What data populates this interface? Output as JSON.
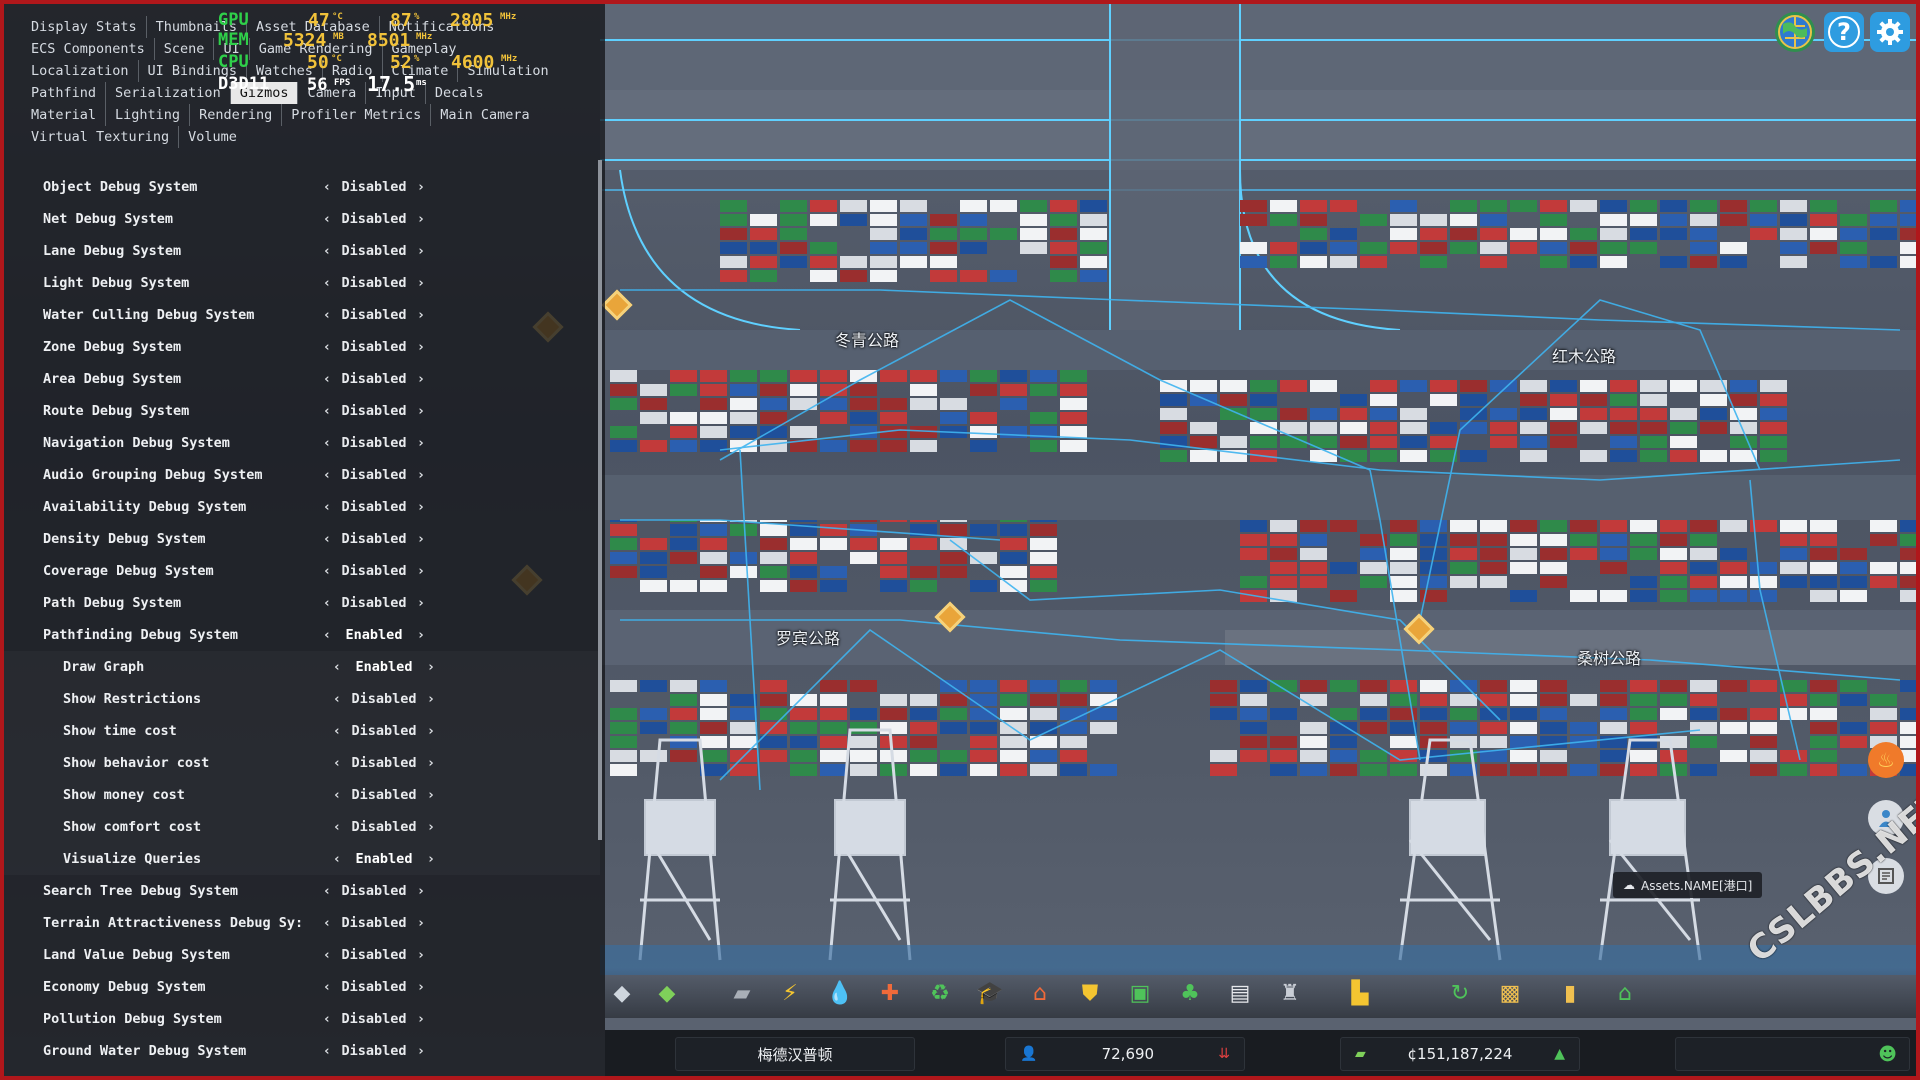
{
  "perf": {
    "gpu_label": "GPU",
    "gpu_temp": "47",
    "gpu_temp_unit": "°C",
    "gpu_load": "87",
    "gpu_load_unit": "%",
    "gpu_clock": "2805",
    "gpu_clock_unit": "MHz",
    "mem_label": "MEM",
    "mem_used": "5324",
    "mem_used_unit": "MB",
    "mem_clock": "8501",
    "mem_clock_unit": "MHz",
    "cpu_label": "CPU",
    "cpu_temp": "50",
    "cpu_temp_unit": "°C",
    "cpu_load": "52",
    "cpu_load_unit": "%",
    "cpu_clock": "4600",
    "cpu_clock_unit": "MHz",
    "api_label": "D3D11",
    "fps": "56",
    "fps_unit": "FPS",
    "frametime": "17.5",
    "frametime_unit": "ms"
  },
  "tabs": {
    "rows": [
      [
        "Display Stats",
        "Thumbnails",
        "Asset Database",
        "Notifications"
      ],
      [
        "ECS Components",
        "Scene",
        "UI",
        "Game Rendering",
        "Gameplay"
      ],
      [
        "Localization",
        "UI Bindings",
        "Watches",
        "Radio",
        "Climate",
        "Simulation"
      ],
      [
        "Pathfind",
        "Serialization",
        "Gizmos",
        "Camera",
        "Input",
        "Decals"
      ],
      [
        "Material",
        "Lighting",
        "Rendering",
        "Profiler Metrics",
        "Main Camera"
      ],
      [
        "Virtual Texturing",
        "Volume"
      ]
    ],
    "active": "Gizmos"
  },
  "settings": [
    {
      "label": "Object Debug System",
      "value": "Disabled",
      "sub": false
    },
    {
      "label": "Net Debug System",
      "value": "Disabled",
      "sub": false
    },
    {
      "label": "Lane Debug System",
      "value": "Disabled",
      "sub": false
    },
    {
      "label": "Light Debug System",
      "value": "Disabled",
      "sub": false
    },
    {
      "label": "Water Culling Debug System",
      "value": "Disabled",
      "sub": false
    },
    {
      "label": "Zone Debug System",
      "value": "Disabled",
      "sub": false
    },
    {
      "label": "Area Debug System",
      "value": "Disabled",
      "sub": false
    },
    {
      "label": "Route Debug System",
      "value": "Disabled",
      "sub": false
    },
    {
      "label": "Navigation Debug System",
      "value": "Disabled",
      "sub": false
    },
    {
      "label": "Audio Grouping Debug System",
      "value": "Disabled",
      "sub": false
    },
    {
      "label": "Availability Debug System",
      "value": "Disabled",
      "sub": false
    },
    {
      "label": "Density Debug System",
      "value": "Disabled",
      "sub": false
    },
    {
      "label": "Coverage Debug System",
      "value": "Disabled",
      "sub": false
    },
    {
      "label": "Path Debug System",
      "value": "Disabled",
      "sub": false
    },
    {
      "label": "Pathfinding Debug System",
      "value": "Enabled",
      "sub": false
    },
    {
      "label": "Draw Graph",
      "value": "Enabled",
      "sub": true
    },
    {
      "label": "Show Restrictions",
      "value": "Disabled",
      "sub": true
    },
    {
      "label": "Show time cost",
      "value": "Disabled",
      "sub": true
    },
    {
      "label": "Show behavior cost",
      "value": "Disabled",
      "sub": true
    },
    {
      "label": "Show money cost",
      "value": "Disabled",
      "sub": true
    },
    {
      "label": "Show comfort cost",
      "value": "Disabled",
      "sub": true
    },
    {
      "label": "Visualize Queries",
      "value": "Enabled",
      "sub": true
    },
    {
      "label": "Search Tree Debug System",
      "value": "Disabled",
      "sub": false
    },
    {
      "label": "Terrain Attractiveness Debug Sy:",
      "value": "Disabled",
      "sub": false
    },
    {
      "label": "Land Value Debug System",
      "value": "Disabled",
      "sub": false
    },
    {
      "label": "Economy Debug System",
      "value": "Disabled",
      "sub": false
    },
    {
      "label": "Pollution Debug System",
      "value": "Disabled",
      "sub": false
    },
    {
      "label": "Ground Water Debug System",
      "value": "Disabled",
      "sub": false
    }
  ],
  "controls": {
    "prev": "‹",
    "next": "›"
  },
  "map": {
    "road_labels": [
      "冬青公路",
      "红木公路",
      "罗宾公路",
      "桑树公路"
    ]
  },
  "top_right": {
    "icons": [
      "globe-icon",
      "help-icon",
      "settings-icon"
    ],
    "help_glyph": "?"
  },
  "toolbar": {
    "tools": [
      {
        "name": "road-tool-icon",
        "glyph": "◆",
        "color": "#cfd6de"
      },
      {
        "name": "zoning-icon",
        "glyph": "◆",
        "color": "#7fd05a"
      },
      {
        "name": "area-tool-icon",
        "glyph": "▰",
        "color": "#a9afb7"
      },
      {
        "name": "electricity-icon",
        "glyph": "⚡",
        "color": "#f4c531"
      },
      {
        "name": "water-icon",
        "glyph": "💧",
        "color": "#3aa7f0"
      },
      {
        "name": "health-icon",
        "glyph": "✚",
        "color": "#f06a3a"
      },
      {
        "name": "recycling-icon",
        "glyph": "♻",
        "color": "#4fc35a"
      },
      {
        "name": "education-icon",
        "glyph": "🎓",
        "color": "#c9ced6"
      },
      {
        "name": "fire-station-icon",
        "glyph": "⌂",
        "color": "#f06a3a"
      },
      {
        "name": "police-icon",
        "glyph": "⛊",
        "color": "#f4c531"
      },
      {
        "name": "transport-icon",
        "glyph": "▣",
        "color": "#4fc35a"
      },
      {
        "name": "parks-icon",
        "glyph": "♣",
        "color": "#4fc35a"
      },
      {
        "name": "communication-icon",
        "glyph": "▤",
        "color": "#e6e8ec"
      },
      {
        "name": "landmark-icon",
        "glyph": "♜",
        "color": "#c9ced6"
      },
      {
        "name": "bulldozer-icon",
        "glyph": "▙",
        "color": "#f4c531"
      },
      {
        "name": "undo-icon",
        "glyph": "↻",
        "color": "#4fc35a"
      },
      {
        "name": "map-tiles-icon",
        "glyph": "▩",
        "color": "#f0c050"
      },
      {
        "name": "statistics-icon",
        "glyph": "▮",
        "color": "#f0c050"
      },
      {
        "name": "policies-icon",
        "glyph": "⌂",
        "color": "#4fc35a"
      }
    ]
  },
  "status": {
    "city_name": "梅德汉普顿",
    "population": "72,690",
    "money": "¢151,187,224"
  },
  "tooltip": {
    "text": "Assets.NAME[港口]"
  },
  "watermark": "CSLBBS.NET",
  "colors": {
    "enabled_accent": "#2fd04a",
    "frame": "#b0171b",
    "marker": "#e9a53a"
  }
}
